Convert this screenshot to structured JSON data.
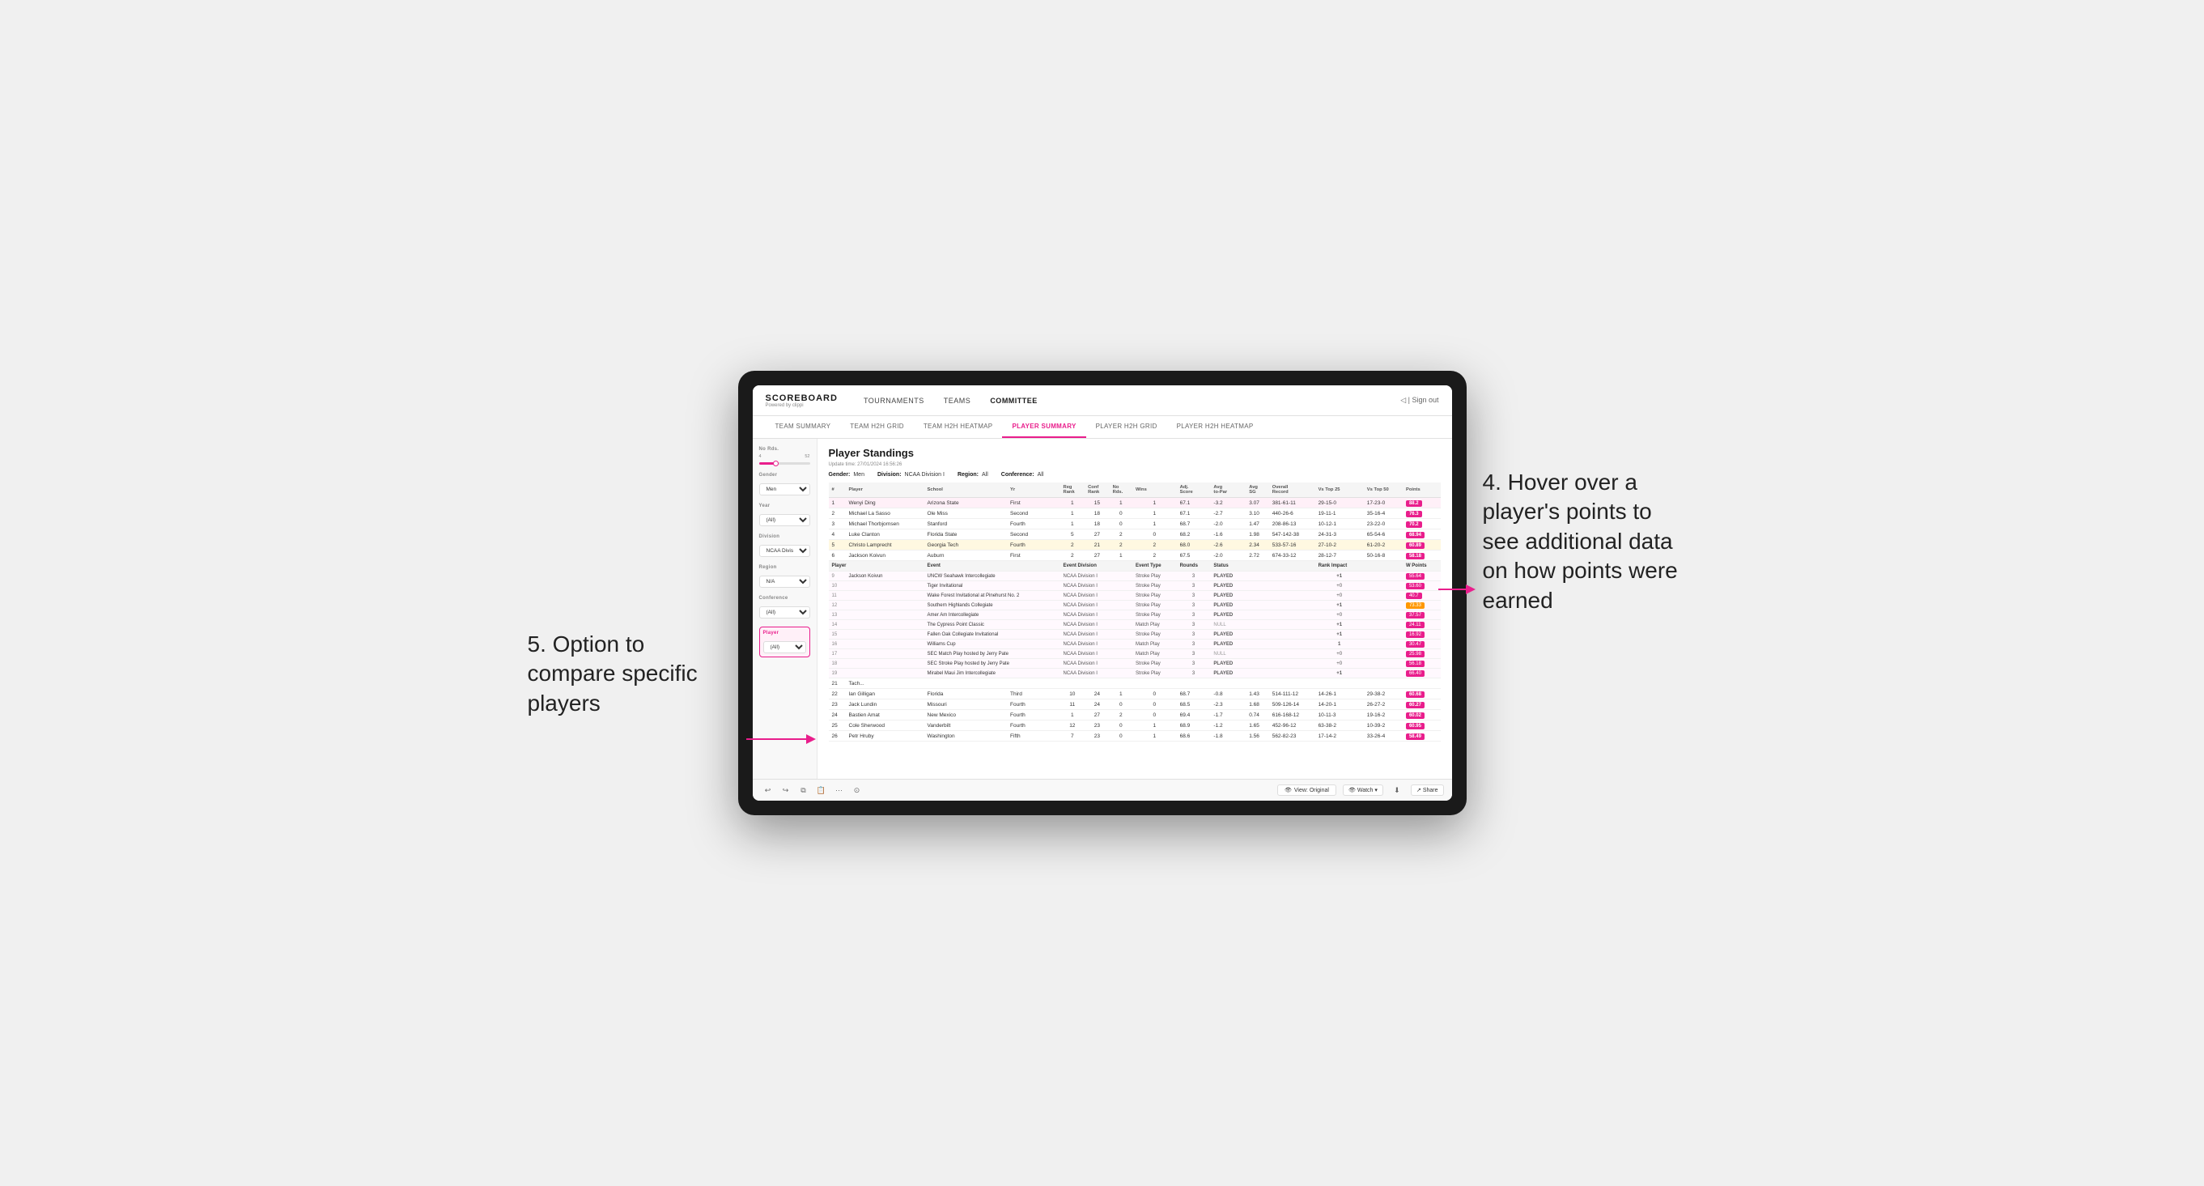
{
  "app": {
    "logo": "SCOREBOARD",
    "logo_sub": "Powered by clippi",
    "nav_items": [
      "TOURNAMENTS",
      "TEAMS",
      "COMMITTEE"
    ],
    "header_right": [
      "◁  |  Sign out"
    ],
    "sub_nav": [
      "TEAM SUMMARY",
      "TEAM H2H GRID",
      "TEAM H2H HEATMAP",
      "PLAYER SUMMARY",
      "PLAYER H2H GRID",
      "PLAYER H2H HEATMAP"
    ],
    "active_sub_nav": "PLAYER SUMMARY"
  },
  "sidebar": {
    "no_rds_label": "No Rds.",
    "no_rds_min": "4",
    "no_rds_max": "52",
    "gender_label": "Gender",
    "gender_value": "Men",
    "year_label": "Year",
    "year_value": "(All)",
    "division_label": "Division",
    "division_value": "NCAA Division I",
    "region_label": "Region",
    "region_value": "N/A",
    "conference_label": "Conference",
    "conference_value": "(All)",
    "player_label": "Player",
    "player_value": "(All)"
  },
  "main": {
    "title": "Player Standings",
    "update_time": "Update time: 27/01/2024 16:56:26",
    "filters": {
      "gender": "Men",
      "division": "NCAA Division I",
      "region": "All",
      "conference": "All"
    },
    "table_headers": [
      "#",
      "Player",
      "School",
      "Yr",
      "Reg Rank",
      "Conf Rank",
      "No Rds.",
      "Wins",
      "Adj. Score",
      "Avg to-Par",
      "Avg SG",
      "Overall Record",
      "Vs Top 25",
      "Vs Top 50",
      "Points"
    ],
    "players": [
      {
        "num": "1",
        "name": "Wenyi Ding",
        "school": "Arizona State",
        "yr": "First",
        "reg_rank": "1",
        "conf_rank": "15",
        "rds": "1",
        "wins": "1",
        "adj_score": "67.1",
        "avg_par": "-3.2",
        "avg_sg": "3.07",
        "record": "381-61-11",
        "vs25": "29-15-0",
        "vs50": "17-23-0",
        "points": "88.2",
        "highlight": true
      },
      {
        "num": "2",
        "name": "Michael La Sasso",
        "school": "Ole Miss",
        "yr": "Second",
        "reg_rank": "1",
        "conf_rank": "18",
        "rds": "0",
        "wins": "1",
        "adj_score": "67.1",
        "avg_par": "-2.7",
        "avg_sg": "3.10",
        "record": "440-26-6",
        "vs25": "19-11-1",
        "vs50": "35-16-4",
        "points": "76.3"
      },
      {
        "num": "3",
        "name": "Michael Thorbjornsen",
        "school": "Stanford",
        "yr": "Fourth",
        "reg_rank": "1",
        "conf_rank": "18",
        "rds": "0",
        "wins": "1",
        "adj_score": "68.7",
        "avg_par": "-2.0",
        "avg_sg": "1.47",
        "record": "208-86-13",
        "vs25": "10-12-1",
        "vs50": "23-22-0",
        "points": "70.2"
      },
      {
        "num": "4",
        "name": "Luke Clanton",
        "school": "Florida State",
        "yr": "Second",
        "reg_rank": "5",
        "conf_rank": "27",
        "rds": "2",
        "wins": "0",
        "adj_score": "68.2",
        "avg_par": "-1.6",
        "avg_sg": "1.98",
        "record": "547-142-38",
        "vs25": "24-31-3",
        "vs50": "65-54-6",
        "points": "68.94"
      },
      {
        "num": "5",
        "name": "Christo Lamprecht",
        "school": "Georgia Tech",
        "yr": "Fourth",
        "reg_rank": "2",
        "conf_rank": "21",
        "rds": "2",
        "wins": "2",
        "adj_score": "68.0",
        "avg_par": "-2.6",
        "avg_sg": "2.34",
        "record": "533-57-16",
        "vs25": "27-10-2",
        "vs50": "61-20-2",
        "points": "60.89",
        "highlighted": true
      },
      {
        "num": "6",
        "name": "Jackson Koivun",
        "school": "Auburn",
        "yr": "First",
        "reg_rank": "2",
        "conf_rank": "27",
        "rds": "1",
        "wins": "2",
        "adj_score": "67.5",
        "avg_par": "-2.0",
        "avg_sg": "2.72",
        "record": "674-33-12",
        "vs25": "28-12-7",
        "vs50": "50-16-8",
        "points": "58.18"
      }
    ],
    "event_detail_player": "Jackson Koivun",
    "event_headers": [
      "Player",
      "Event",
      "Event Division",
      "Event Type",
      "Rounds",
      "Status",
      "Rank Impact",
      "W Points"
    ],
    "events": [
      {
        "num": "9",
        "player": "Jackson Koivun",
        "event": "UNCW Seahawk Intercollegiate",
        "division": "NCAA Division I",
        "type": "Stroke Play",
        "rounds": "3",
        "status": "PLAYED",
        "rank_impact": "+1",
        "w_points": "55.64",
        "badge": "pink"
      },
      {
        "num": "10",
        "player": "",
        "event": "Tiger Invitational",
        "division": "NCAA Division I",
        "type": "Stroke Play",
        "rounds": "3",
        "status": "PLAYED",
        "rank_impact": "+0",
        "w_points": "53.60",
        "badge": "pink"
      },
      {
        "num": "11",
        "player": "",
        "event": "Wake Forest Invitational at Pinehurst No. 2",
        "division": "NCAA Division I",
        "type": "Stroke Play",
        "rounds": "3",
        "status": "PLAYED",
        "rank_impact": "+0",
        "w_points": "40.7",
        "badge": "pink"
      },
      {
        "num": "12",
        "player": "",
        "event": "Southern Highlands Collegiate",
        "division": "NCAA Division I",
        "type": "Stroke Play",
        "rounds": "3",
        "status": "PLAYED",
        "rank_impact": "+1",
        "w_points": "73.33",
        "badge": "orange"
      },
      {
        "num": "13",
        "player": "",
        "event": "Amer Am Intercollegiate",
        "division": "NCAA Division I",
        "type": "Stroke Play",
        "rounds": "3",
        "status": "PLAYED",
        "rank_impact": "+0",
        "w_points": "37.57",
        "badge": "pink"
      },
      {
        "num": "14",
        "player": "",
        "event": "The Cypress Point Classic",
        "division": "NCAA Division I",
        "type": "Match Play",
        "rounds": "3",
        "status": "NULL",
        "rank_impact": "+1",
        "w_points": "24.11",
        "badge": "pink"
      },
      {
        "num": "15",
        "player": "",
        "event": "Fallen Oak Collegiate Invitational",
        "division": "NCAA Division I",
        "type": "Stroke Play",
        "rounds": "3",
        "status": "PLAYED",
        "rank_impact": "+1",
        "w_points": "16.92",
        "badge": "pink"
      },
      {
        "num": "16",
        "player": "",
        "event": "Williams Cup",
        "division": "NCAA Division I",
        "type": "Match Play",
        "rounds": "3",
        "status": "PLAYED",
        "rank_impact": "1",
        "w_points": "30.47",
        "badge": "pink"
      },
      {
        "num": "17",
        "player": "",
        "event": "SEC Match Play hosted by Jerry Pate",
        "division": "NCAA Division I",
        "type": "Match Play",
        "rounds": "3",
        "status": "NULL",
        "rank_impact": "+0",
        "w_points": "25.98",
        "badge": "pink"
      },
      {
        "num": "18",
        "player": "",
        "event": "SEC Stroke Play hosted by Jerry Pate",
        "division": "NCAA Division I",
        "type": "Stroke Play",
        "rounds": "3",
        "status": "PLAYED",
        "rank_impact": "+0",
        "w_points": "56.18",
        "badge": "pink"
      },
      {
        "num": "19",
        "player": "",
        "event": "Mirabel Maui Jim Intercollegiate",
        "division": "NCAA Division I",
        "type": "Stroke Play",
        "rounds": "3",
        "status": "PLAYED",
        "rank_impact": "+1",
        "w_points": "66.40",
        "badge": "pink"
      }
    ],
    "players_below": [
      {
        "num": "21",
        "name": "Tach...",
        "school": "",
        "yr": "",
        "reg_rank": "",
        "conf_rank": "",
        "rds": "",
        "wins": "",
        "adj_score": "",
        "avg_par": "",
        "avg_sg": "",
        "record": "",
        "vs25": "",
        "vs50": "",
        "points": ""
      },
      {
        "num": "22",
        "name": "Ian Gilligan",
        "school": "Florida",
        "yr": "Third",
        "reg_rank": "10",
        "conf_rank": "24",
        "rds": "1",
        "wins": "0",
        "adj_score": "68.7",
        "avg_par": "-0.8",
        "avg_sg": "1.43",
        "record": "514-111-12",
        "vs25": "14-26-1",
        "vs50": "29-38-2",
        "points": "60.68"
      },
      {
        "num": "23",
        "name": "Jack Lundin",
        "school": "Missouri",
        "yr": "Fourth",
        "reg_rank": "11",
        "conf_rank": "24",
        "rds": "0",
        "wins": "0",
        "adj_score": "68.5",
        "avg_par": "-2.3",
        "avg_sg": "1.68",
        "record": "509-126-14",
        "vs25": "14-20-1",
        "vs50": "26-27-2",
        "points": "60.27"
      },
      {
        "num": "24",
        "name": "Bastien Amat",
        "school": "New Mexico",
        "yr": "Fourth",
        "reg_rank": "1",
        "conf_rank": "27",
        "rds": "2",
        "wins": "0",
        "adj_score": "69.4",
        "avg_par": "-1.7",
        "avg_sg": "0.74",
        "record": "616-168-12",
        "vs25": "10-11-3",
        "vs50": "19-16-2",
        "points": "60.02"
      },
      {
        "num": "25",
        "name": "Cole Sherwood",
        "school": "Vanderbilt",
        "yr": "Fourth",
        "reg_rank": "12",
        "conf_rank": "23",
        "rds": "0",
        "wins": "1",
        "adj_score": "68.9",
        "avg_par": "-1.2",
        "avg_sg": "1.65",
        "record": "452-96-12",
        "vs25": "63-38-2",
        "vs50": "10-39-2",
        "points": "60.95"
      },
      {
        "num": "26",
        "name": "Petr Hruby",
        "school": "Washington",
        "yr": "Fifth",
        "reg_rank": "7",
        "conf_rank": "23",
        "rds": "0",
        "wins": "1",
        "adj_score": "68.6",
        "avg_par": "-1.8",
        "avg_sg": "1.56",
        "record": "562-82-23",
        "vs25": "17-14-2",
        "vs50": "33-26-4",
        "points": "58.49"
      }
    ]
  },
  "annotations": {
    "right_text": "4. Hover over a player's points to see additional data on how points were earned",
    "left_text": "5. Option to compare specific players"
  },
  "footer": {
    "view_label": "View: Original",
    "watch_label": "Watch",
    "share_label": "Share"
  }
}
